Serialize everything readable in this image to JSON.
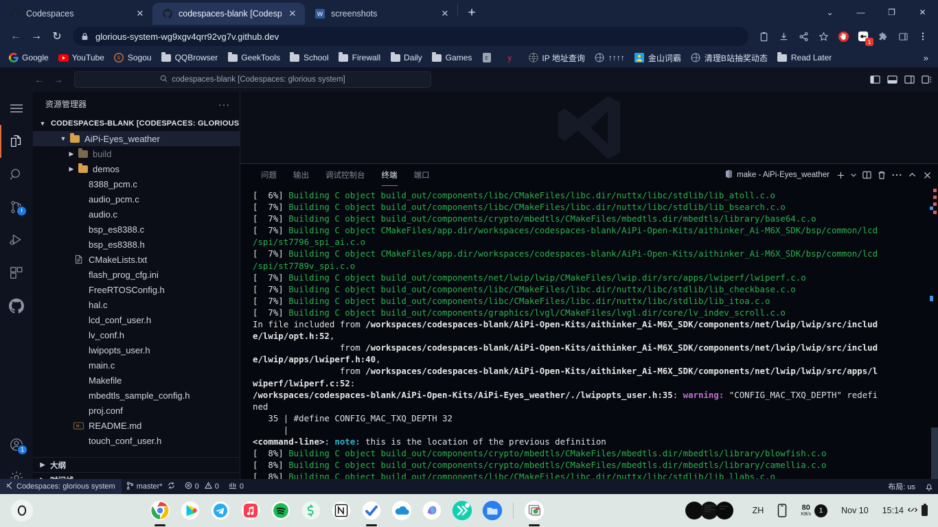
{
  "browser": {
    "tabs": [
      {
        "title": "Codespaces",
        "icon": "github-icon",
        "active": false
      },
      {
        "title": "codespaces-blank [Codespaces",
        "icon": "github-icon",
        "active": true
      },
      {
        "title": "screenshots",
        "icon": "word-icon",
        "active": false
      }
    ],
    "new_tab_label": "+",
    "window_controls": {
      "list": "⌄",
      "minimize": "—",
      "maximize": "❐",
      "close": "✕"
    },
    "nav": {
      "back": "←",
      "forward": "→",
      "reload": "↻"
    },
    "address": "glorious-system-wg9xgv4qrr92vg7v.github.dev",
    "toolbar_icons": [
      "clipboard-icon",
      "download-icon",
      "share-icon",
      "star-icon",
      "adblock-icon",
      "extension-badge-icon",
      "puzzle-icon",
      "sidepanel-icon",
      "menu-dots-icon"
    ],
    "extension_badge_count": "1",
    "bookmarks": [
      {
        "label": "Google",
        "icon": "google-icon"
      },
      {
        "label": "YouTube",
        "icon": "youtube-icon"
      },
      {
        "label": "Sogou",
        "icon": "sogou-icon"
      },
      {
        "label": "QQBrowser",
        "icon": "folder-icon"
      },
      {
        "label": "GeekTools",
        "icon": "folder-icon"
      },
      {
        "label": "School",
        "icon": "folder-icon"
      },
      {
        "label": "Firewall",
        "icon": "folder-icon"
      },
      {
        "label": "Daily",
        "icon": "folder-icon"
      },
      {
        "label": "Games",
        "icon": "folder-icon"
      },
      {
        "label": "",
        "icon": "epic-icon"
      },
      {
        "label": "",
        "icon": "y-icon"
      },
      {
        "label": "IP 地址查询",
        "icon": "globe-dark-icon"
      },
      {
        "label": "↑↑↑↑",
        "icon": "globe-icon"
      },
      {
        "label": "金山词霸",
        "icon": "kingsoft-icon"
      },
      {
        "label": "清理B站抽奖动态",
        "icon": "globe-icon"
      },
      {
        "label": "Read Later",
        "icon": "folder-icon"
      }
    ],
    "bookmarks_overflow": "»"
  },
  "vscode": {
    "command_center": "codespaces-blank [Codespaces: glorious system]",
    "titlebar_nav": {
      "back": "←",
      "forward": "→"
    },
    "layout_icons": [
      "toggle-primary-sidebar-icon",
      "toggle-panel-icon",
      "toggle-secondary-sidebar-icon",
      "customize-layout-icon"
    ],
    "activitybar": [
      {
        "name": "menu-icon",
        "label": ""
      },
      {
        "name": "explorer-icon",
        "label": "",
        "active": true
      },
      {
        "name": "search-icon",
        "label": ""
      },
      {
        "name": "source-control-icon",
        "label": ""
      },
      {
        "name": "run-debug-icon",
        "label": ""
      },
      {
        "name": "extensions-icon",
        "label": ""
      },
      {
        "name": "github-icon",
        "label": ""
      },
      {
        "name": "accounts-icon",
        "label": "",
        "badge": "1"
      },
      {
        "name": "settings-gear-icon",
        "label": ""
      }
    ],
    "sidebar": {
      "title": "资源管理器",
      "more_actions": "···",
      "root": "CODESPACES-BLANK [CODESPACES: GLORIOUS...",
      "tree": [
        {
          "label": "AiPi-Eyes_weather",
          "type": "folder",
          "indent": 2,
          "expanded": true,
          "selected": true
        },
        {
          "label": "build",
          "type": "folder-muted",
          "indent": 3,
          "collapsed": true,
          "dim": true
        },
        {
          "label": "demos",
          "type": "folder",
          "indent": 3,
          "collapsed": true
        },
        {
          "label": "8388_pcm.c",
          "type": "file",
          "indent": 4
        },
        {
          "label": "audio_pcm.c",
          "type": "file",
          "indent": 4
        },
        {
          "label": "audio.c",
          "type": "file",
          "indent": 4
        },
        {
          "label": "bsp_es8388.c",
          "type": "file",
          "indent": 4
        },
        {
          "label": "bsp_es8388.h",
          "type": "file",
          "indent": 4
        },
        {
          "label": "CMakeLists.txt",
          "type": "txt",
          "indent": 4
        },
        {
          "label": "flash_prog_cfg.ini",
          "type": "file",
          "indent": 4
        },
        {
          "label": "FreeRTOSConfig.h",
          "type": "file",
          "indent": 4
        },
        {
          "label": "hal.c",
          "type": "file",
          "indent": 4
        },
        {
          "label": "lcd_conf_user.h",
          "type": "file",
          "indent": 4
        },
        {
          "label": "lv_conf.h",
          "type": "file",
          "indent": 4
        },
        {
          "label": "lwipopts_user.h",
          "type": "file",
          "indent": 4
        },
        {
          "label": "main.c",
          "type": "file",
          "indent": 4
        },
        {
          "label": "Makefile",
          "type": "file",
          "indent": 4
        },
        {
          "label": "mbedtls_sample_config.h",
          "type": "file",
          "indent": 4
        },
        {
          "label": "proj.conf",
          "type": "file",
          "indent": 4
        },
        {
          "label": "README.md",
          "type": "md",
          "indent": 4
        },
        {
          "label": "touch_conf_user.h",
          "type": "file",
          "indent": 4
        }
      ],
      "sections": [
        {
          "label": "大纲"
        },
        {
          "label": "时间线"
        }
      ]
    },
    "panel": {
      "tabs": [
        {
          "label": "问题",
          "active": false
        },
        {
          "label": "输出",
          "active": false
        },
        {
          "label": "调试控制台",
          "active": false
        },
        {
          "label": "终端",
          "active": true
        },
        {
          "label": "端口",
          "active": false
        }
      ],
      "terminal_name": "make - AiPi-Eyes_weather",
      "actions": [
        "new-terminal-icon",
        "chevron-down-icon",
        "split-terminal-icon",
        "kill-terminal-icon",
        "more-actions-icon",
        "maximize-panel-icon",
        "close-panel-icon"
      ]
    },
    "terminal_lines": [
      [
        {
          "t": "[  6%] ",
          "c": "w"
        },
        {
          "t": "Building C object build_out/components/libc/CMakeFiles/libc.dir/nuttx/libc/stdlib/lib_atoll.c.o",
          "c": "g"
        }
      ],
      [
        {
          "t": "[  7%] ",
          "c": "w"
        },
        {
          "t": "Building C object build_out/components/libc/CMakeFiles/libc.dir/nuttx/libc/stdlib/lib_bsearch.c.o",
          "c": "g"
        }
      ],
      [
        {
          "t": "[  7%] ",
          "c": "w"
        },
        {
          "t": "Building C object build_out/components/crypto/mbedtls/CMakeFiles/mbedtls.dir/mbedtls/library/base64.c.o",
          "c": "g"
        }
      ],
      [
        {
          "t": "[  7%] ",
          "c": "w"
        },
        {
          "t": "Building C object CMakeFiles/app.dir/workspaces/codespaces-blank/AiPi-Open-Kits/aithinker_Ai-M6X_SDK/bsp/common/lcd",
          "c": "g"
        }
      ],
      [
        {
          "t": "/spi/st7796_spi_ai.c.o",
          "c": "g"
        }
      ],
      [
        {
          "t": "[  7%] ",
          "c": "w"
        },
        {
          "t": "Building C object CMakeFiles/app.dir/workspaces/codespaces-blank/AiPi-Open-Kits/aithinker_Ai-M6X_SDK/bsp/common/lcd",
          "c": "g"
        }
      ],
      [
        {
          "t": "/spi/st7789v_spi.c.o",
          "c": "g"
        }
      ],
      [
        {
          "t": "[  7%] ",
          "c": "w"
        },
        {
          "t": "Building C object build_out/components/net/lwip/lwip/CMakeFiles/lwip.dir/src/apps/lwiperf/lwiperf.c.o",
          "c": "g"
        }
      ],
      [
        {
          "t": "[  7%] ",
          "c": "w"
        },
        {
          "t": "Building C object build_out/components/libc/CMakeFiles/libc.dir/nuttx/libc/stdlib/lib_checkbase.c.o",
          "c": "g"
        }
      ],
      [
        {
          "t": "[  7%] ",
          "c": "w"
        },
        {
          "t": "Building C object build_out/components/libc/CMakeFiles/libc.dir/nuttx/libc/stdlib/lib_itoa.c.o",
          "c": "g"
        }
      ],
      [
        {
          "t": "[  7%] ",
          "c": "w"
        },
        {
          "t": "Building C object build_out/components/graphics/lvgl/CMakeFiles/lvgl.dir/core/lv_indev_scroll.c.o",
          "c": "g"
        }
      ],
      [
        {
          "t": "In file included from ",
          "c": "w"
        },
        {
          "t": "/workspaces/codespaces-blank/AiPi-Open-Kits/aithinker_Ai-M6X_SDK/components/net/lwip/lwip/src/includ",
          "c": "b"
        }
      ],
      [
        {
          "t": "e/lwip/opt.h:52",
          "c": "b"
        },
        {
          "t": ",",
          "c": "w"
        }
      ],
      [
        {
          "t": "                 from ",
          "c": "w"
        },
        {
          "t": "/workspaces/codespaces-blank/AiPi-Open-Kits/aithinker_Ai-M6X_SDK/components/net/lwip/lwip/src/includ",
          "c": "b"
        }
      ],
      [
        {
          "t": "e/lwip/apps/lwiperf.h:40",
          "c": "b"
        },
        {
          "t": ",",
          "c": "w"
        }
      ],
      [
        {
          "t": "                 from ",
          "c": "w"
        },
        {
          "t": "/workspaces/codespaces-blank/AiPi-Open-Kits/aithinker_Ai-M6X_SDK/components/net/lwip/lwip/src/apps/l",
          "c": "b"
        }
      ],
      [
        {
          "t": "wiperf/lwiperf.c:52",
          "c": "b"
        },
        {
          "t": ":",
          "c": "w"
        }
      ],
      [
        {
          "t": "/workspaces/codespaces-blank/AiPi-Open-Kits/AiPi-Eyes_weather/./lwipopts_user.h:35",
          "c": "b"
        },
        {
          "t": ": ",
          "c": "w"
        },
        {
          "t": "warning:",
          "c": "mag"
        },
        {
          "t": " \"CONFIG_MAC_TXQ_DEPTH\" redefi",
          "c": "w"
        }
      ],
      [
        {
          "t": "ned",
          "c": "w"
        }
      ],
      [
        {
          "t": "   35 | #define CONFIG_MAC_TXQ_DEPTH 32",
          "c": "w"
        }
      ],
      [
        {
          "t": "      |",
          "c": "w"
        }
      ],
      [
        {
          "t": "<command-line>",
          "c": "b"
        },
        {
          "t": ": ",
          "c": "w"
        },
        {
          "t": "note:",
          "c": "cy"
        },
        {
          "t": " this is the location of the previous definition",
          "c": "w"
        }
      ],
      [
        {
          "t": "[  8%] ",
          "c": "w"
        },
        {
          "t": "Building C object build_out/components/crypto/mbedtls/CMakeFiles/mbedtls.dir/mbedtls/library/blowfish.c.o",
          "c": "g"
        }
      ],
      [
        {
          "t": "[  8%] ",
          "c": "w"
        },
        {
          "t": "Building C object build_out/components/crypto/mbedtls/CMakeFiles/mbedtls.dir/mbedtls/library/camellia.c.o",
          "c": "g"
        }
      ],
      [
        {
          "t": "[  8%] ",
          "c": "w"
        },
        {
          "t": "Building C object build_out/components/libc/CMakeFiles/libc.dir/nuttx/libc/stdlib/lib_llabs.c.o",
          "c": "g"
        }
      ],
      [
        {
          "t": "█",
          "c": "cursor"
        }
      ]
    ],
    "statusbar": {
      "remote": "Codespaces: glorious system",
      "branch": "master*",
      "sync_icon": "sync-icon",
      "errors": "0",
      "warnings": "0",
      "ports": "0",
      "layout": "布局: us",
      "bell": "bell-icon"
    }
  },
  "taskbar": {
    "start": "start-icon",
    "apps": [
      {
        "name": "chrome-icon",
        "running": true
      },
      {
        "name": "google-play-icon",
        "running": false
      },
      {
        "name": "telegram-icon",
        "running": false
      },
      {
        "name": "apple-music-icon",
        "running": false
      },
      {
        "name": "spotify-icon",
        "running": false
      },
      {
        "name": "surfshark-icon",
        "running": false
      },
      {
        "name": "notion-icon",
        "running": false
      },
      {
        "name": "todoist-icon",
        "running": true
      },
      {
        "name": "onedrive-icon",
        "running": false
      },
      {
        "name": "copilot-icon",
        "running": false
      },
      {
        "name": "fast-forward-icon",
        "running": false
      },
      {
        "name": "file-explorer-icon",
        "running": false
      },
      {
        "name": "chrome-apps-icon",
        "running": true
      }
    ],
    "tray": {
      "thumbnails": "window-thumbnails",
      "ime": "ZH",
      "phone_link": "phone-icon",
      "net_speed_value": "80",
      "net_speed_unit": "KB/s",
      "net_badge": "1",
      "date": "Nov 10",
      "time": "15:14",
      "connect_icon": "connect-icon",
      "battery": "battery-icon"
    }
  }
}
